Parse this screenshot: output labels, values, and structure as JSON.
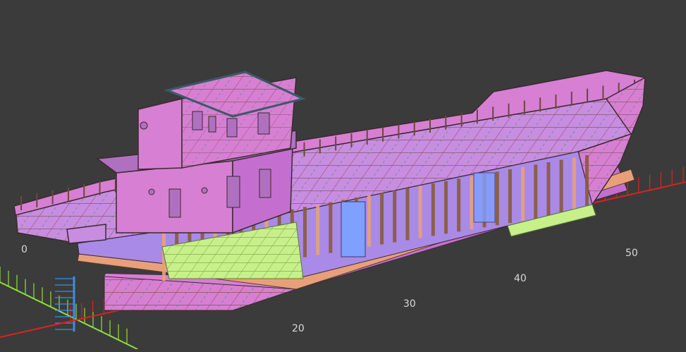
{
  "viewport": {
    "background": "#3b3b3b",
    "model": "ship-hull-structure-3d",
    "frame_labels": [
      "0",
      "20",
      "30",
      "40",
      "50"
    ]
  },
  "colors": {
    "shell_plate": "#d77fd3",
    "deck_plate": "#c88de0",
    "bulkhead": "#a98ae6",
    "stiffener": "#8a5a3a",
    "girder": "#e8a07a",
    "floor_plate": "#c8f08a",
    "blue_member": "#7fa0ff",
    "seam_line": "#2f8f5f",
    "frame_tick_red": "#e02020",
    "axis_green": "#8ee03a",
    "axis_blue": "#3a8ee0"
  }
}
